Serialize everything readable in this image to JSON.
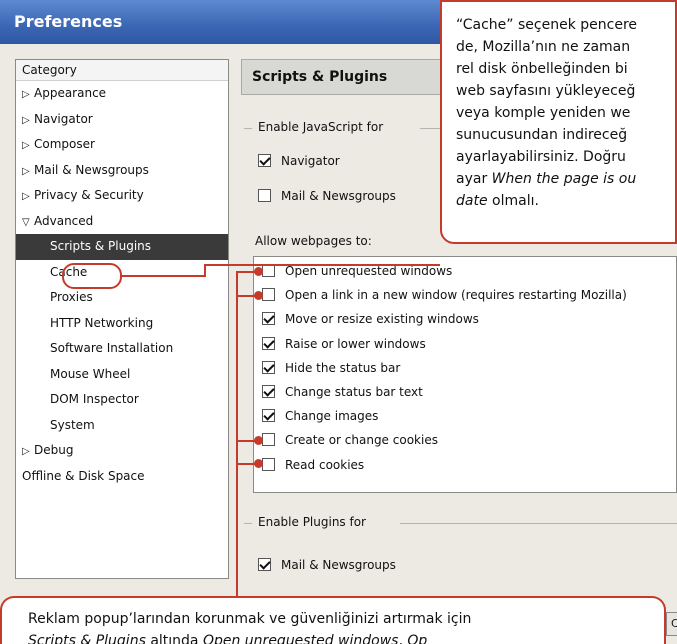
{
  "window": {
    "title": "Preferences"
  },
  "tree": {
    "header": "Category",
    "items": [
      {
        "label": "Appearance",
        "level": 0,
        "twisty": "▷"
      },
      {
        "label": "Navigator",
        "level": 0,
        "twisty": "▷"
      },
      {
        "label": "Composer",
        "level": 0,
        "twisty": "▷"
      },
      {
        "label": "Mail & Newsgroups",
        "level": 0,
        "twisty": "▷"
      },
      {
        "label": "Privacy & Security",
        "level": 0,
        "twisty": "▷"
      },
      {
        "label": "Advanced",
        "level": 0,
        "twisty": "▽"
      },
      {
        "label": "Scripts & Plugins",
        "level": 1,
        "selected": true
      },
      {
        "label": "Cache",
        "level": 1
      },
      {
        "label": "Proxies",
        "level": 1
      },
      {
        "label": "HTTP Networking",
        "level": 1
      },
      {
        "label": "Software Installation",
        "level": 1
      },
      {
        "label": "Mouse Wheel",
        "level": 1
      },
      {
        "label": "DOM Inspector",
        "level": 1
      },
      {
        "label": "System",
        "level": 1
      },
      {
        "label": "Debug",
        "level": 0,
        "twisty": "▷"
      },
      {
        "label": "Offline & Disk Space",
        "level": 0,
        "twisty": ""
      }
    ]
  },
  "panel": {
    "title": "Scripts & Plugins",
    "js_group": {
      "title": "Enable JavaScript for",
      "options": [
        {
          "label": "Navigator",
          "checked": true
        },
        {
          "label": "Mail & Newsgroups",
          "checked": false
        }
      ]
    },
    "allow": {
      "title": "Allow webpages to:",
      "options": [
        {
          "label": "Open unrequested windows",
          "checked": false
        },
        {
          "label": "Open a link in a new window (requires restarting Mozilla)",
          "checked": false
        },
        {
          "label": "Move or resize existing windows",
          "checked": true
        },
        {
          "label": "Raise or lower windows",
          "checked": true
        },
        {
          "label": "Hide the status bar",
          "checked": true
        },
        {
          "label": "Change status bar text",
          "checked": true
        },
        {
          "label": "Change images",
          "checked": true
        },
        {
          "label": "Create or change cookies",
          "checked": false
        },
        {
          "label": "Read cookies",
          "checked": false
        }
      ]
    },
    "plugins_group": {
      "title": "Enable Plugins for",
      "options": [
        {
          "label": "Mail & Newsgroups",
          "checked": true
        }
      ]
    },
    "cancel_label": "Cance"
  },
  "callout_top": {
    "lines": [
      "“Cache” seçenek pencere",
      "de, Mozilla’nın ne zaman",
      "rel disk önbelleğinden bi",
      "web sayfasını yükleyeceğ",
      "veya komple yeniden we",
      "sunucusundan indireceğ",
      "ayarlayabilirsiniz. Doğru"
    ],
    "line8_prefix": "ayar ",
    "line8_em": "When the page is ou",
    "line9_em": "date",
    "line9_suffix": " olmalı."
  },
  "callout_bottom": {
    "line1": "Reklam popup’larından korunmak ve güvenliğinizi artırmak için",
    "line2_em1": "Scripts & Plugins",
    "line2_mid1": " altında ",
    "line2_em2": "Open unrequested windows",
    "line2_mid2": ", ",
    "line2_em3": "Op"
  },
  "colors": {
    "accent_red": "#c53a2a",
    "titlebar_blue": "#3b66b3",
    "selection": "#3a3a3a"
  }
}
